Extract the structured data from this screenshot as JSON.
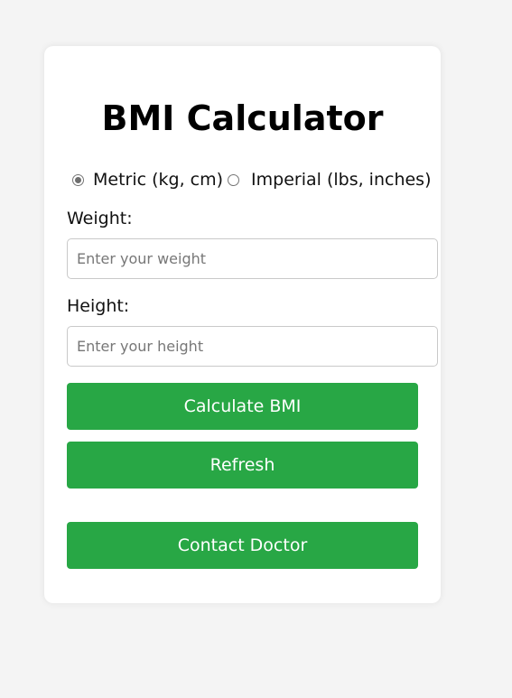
{
  "card": {
    "title": "BMI Calculator",
    "unit_options": [
      {
        "label": "Metric (kg, cm)",
        "checked": true
      },
      {
        "label": "Imperial (lbs, inches)",
        "checked": false
      }
    ],
    "weight": {
      "label": "Weight:",
      "value": "",
      "placeholder": "Enter your weight"
    },
    "height": {
      "label": "Height:",
      "value": "",
      "placeholder": "Enter your height"
    },
    "buttons": {
      "calculate": "Calculate BMI",
      "refresh": "Refresh",
      "contact": "Contact Doctor"
    }
  },
  "colors": {
    "button_bg": "#28a745",
    "page_bg": "#f4f4f4",
    "card_bg": "#ffffff"
  }
}
